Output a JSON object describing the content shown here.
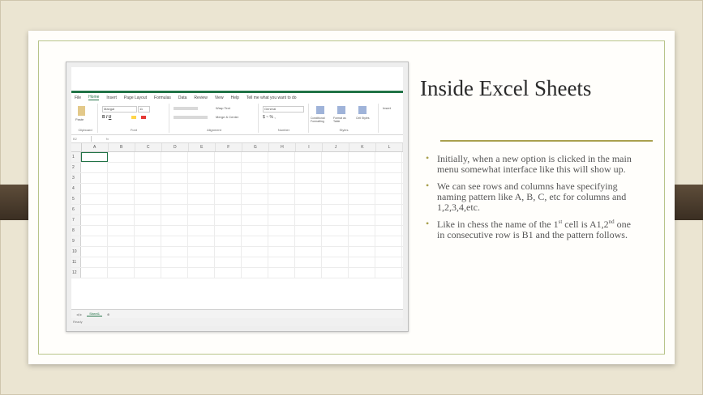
{
  "slide": {
    "title": "Inside Excel Sheets",
    "bullet_marker": "•",
    "bullets": [
      {
        "parts": [
          "Initially, when a new option is clicked in the main menu somewhat interface like this will show up."
        ]
      },
      {
        "parts": [
          "We can see rows and columns have specifying naming pattern like A, B, C, etc for columns and 1,2,3,4,etc."
        ]
      },
      {
        "parts": [
          "Like in chess the name of the 1",
          "st",
          " cell is A1,2",
          "nd",
          " one in consecutive row is B1 and the pattern follows."
        ]
      }
    ]
  },
  "excel": {
    "menu": [
      "File",
      "Home",
      "Insert",
      "Page Layout",
      "Formulas",
      "Data",
      "Review",
      "View",
      "Help",
      "Tell me what you want to do"
    ],
    "ribbon_groups": [
      "Clipboard",
      "Font",
      "Alignment",
      "Number",
      "Styles"
    ],
    "ribbon_texts": {
      "paste": "Paste",
      "font_name": "Mangal",
      "font_size": "11",
      "wrap_text": "Wrap Text",
      "merge": "Merge & Center",
      "number_format": "General",
      "conditional": "Conditional Formatting",
      "format_table": "Format as Table",
      "cell_styles": "Cell Styles",
      "insert": "Insert"
    },
    "name_box": "B2",
    "fx": "fx",
    "columns": [
      "A",
      "B",
      "C",
      "D",
      "E",
      "F",
      "G",
      "H",
      "I",
      "J",
      "K",
      "L"
    ],
    "rows": [
      "1",
      "2",
      "3",
      "4",
      "5",
      "6",
      "7",
      "8",
      "9",
      "10",
      "11",
      "12"
    ],
    "sheet_tab": "Sheet1",
    "status": "Ready"
  }
}
